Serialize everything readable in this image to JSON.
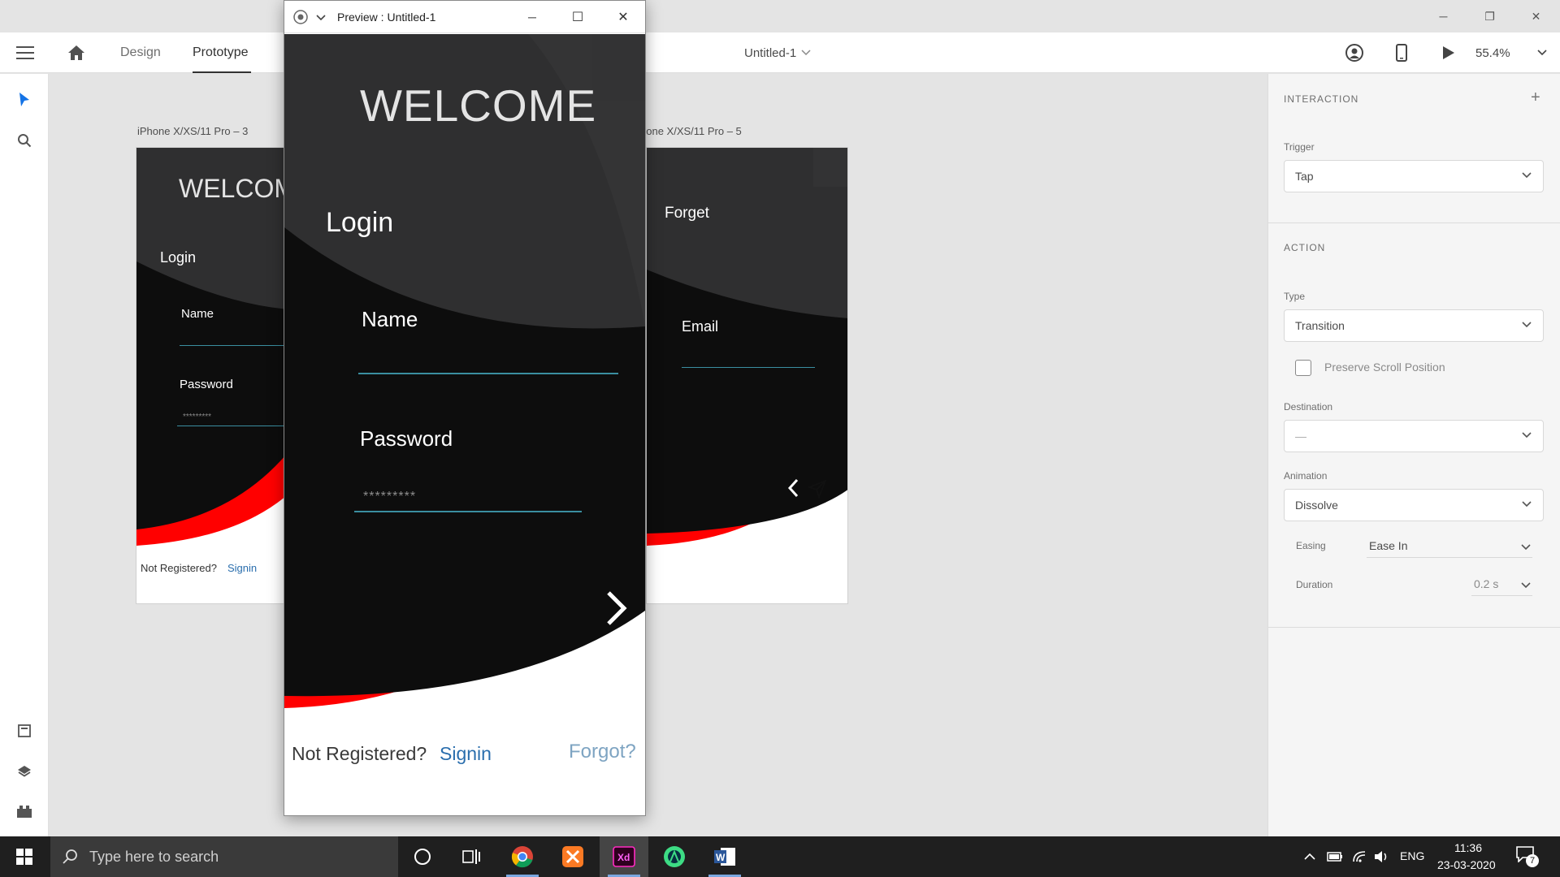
{
  "window": {
    "controls": {
      "minimize": "─",
      "restore": "❐",
      "close": "✕"
    }
  },
  "toolbar": {
    "tabs": [
      {
        "label": "Design"
      },
      {
        "label": "Prototype"
      }
    ],
    "document_title": "Untitled-1",
    "zoom": "55.4%"
  },
  "canvas": {
    "artboard_left_label": "iPhone X/XS/11 Pro – 3",
    "artboard_right_label": "hone X/XS/11 Pro – 5",
    "left_artboard": {
      "welcome": "WELCOM",
      "login": "Login",
      "name_label": "Name",
      "password_label": "Password",
      "password_dots": "*********",
      "not_registered": "Not Registered?",
      "signin": "Signin"
    },
    "right_artboard": {
      "forget": "Forget",
      "email_label": "Email"
    }
  },
  "preview": {
    "title": "Preview : Untitled-1",
    "controls": {
      "minimize": "─",
      "maximize": "☐",
      "close": "✕"
    },
    "welcome": "WELCOME",
    "login": "Login",
    "name_label": "Name",
    "password_label": "Password",
    "password_dots": "*********",
    "not_registered": "Not Registered?",
    "signin": "Signin",
    "forgot": "Forgot?"
  },
  "right_panel": {
    "interaction_title": "INTERACTION",
    "trigger_label": "Trigger",
    "trigger_value": "Tap",
    "action_title": "ACTION",
    "type_label": "Type",
    "type_value": "Transition",
    "preserve_scroll_label": "Preserve Scroll Position",
    "destination_label": "Destination",
    "destination_value": "—",
    "animation_label": "Animation",
    "animation_value": "Dissolve",
    "easing_label": "Easing",
    "easing_value": "Ease In",
    "duration_label": "Duration",
    "duration_value": "0.2 s"
  },
  "taskbar": {
    "search_placeholder": "Type here to search",
    "language": "ENG",
    "time": "11:36",
    "date": "23-03-2020",
    "notification_count": "7"
  },
  "colors": {
    "accent_blue": "#1473e6",
    "dark_bg": "#0d0d0d",
    "gray_shape": "#2f2f30",
    "red_shape": "#ff0000",
    "link_blue": "#2a6ead"
  }
}
